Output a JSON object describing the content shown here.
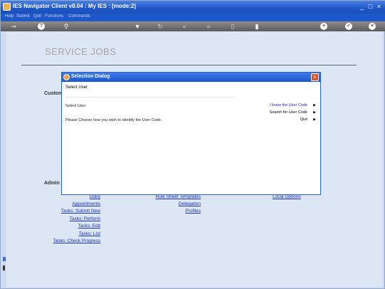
{
  "window": {
    "title": "IES Navigator Client v8.04 : My IES :       [mode:2]",
    "controls": [
      "_",
      "□",
      "×"
    ]
  },
  "menubar": [
    "Help",
    "Submit",
    "Quit",
    "Functions",
    "Commands"
  ],
  "page": {
    "title": "SERVICE JOBS",
    "section_customer": "Custom",
    "section_admin": "Admin"
  },
  "links": {
    "col1": [
      "Diary",
      "Appointments",
      "Tasks: Submit New",
      "Tasks: Perform",
      "Tasks: Edit",
      "Tasks: List",
      "Tasks: Check Progress"
    ],
    "col2": [
      "Rule Sheet Templates",
      "Delegation",
      "Profiles"
    ],
    "col3": [
      "Local Options"
    ]
  },
  "dialog": {
    "title": "Selection Dialog",
    "heading": "Select User",
    "label": "Select User",
    "instruction": "Please Choose how you wish to identify the User Code.",
    "options": [
      "I know the User Code",
      "Search for User Code",
      "Quit"
    ],
    "selected_index": 0
  },
  "colors": {
    "accent": "#1f57c8",
    "link": "#1a2fb8",
    "workarea": "#dce6f4"
  }
}
